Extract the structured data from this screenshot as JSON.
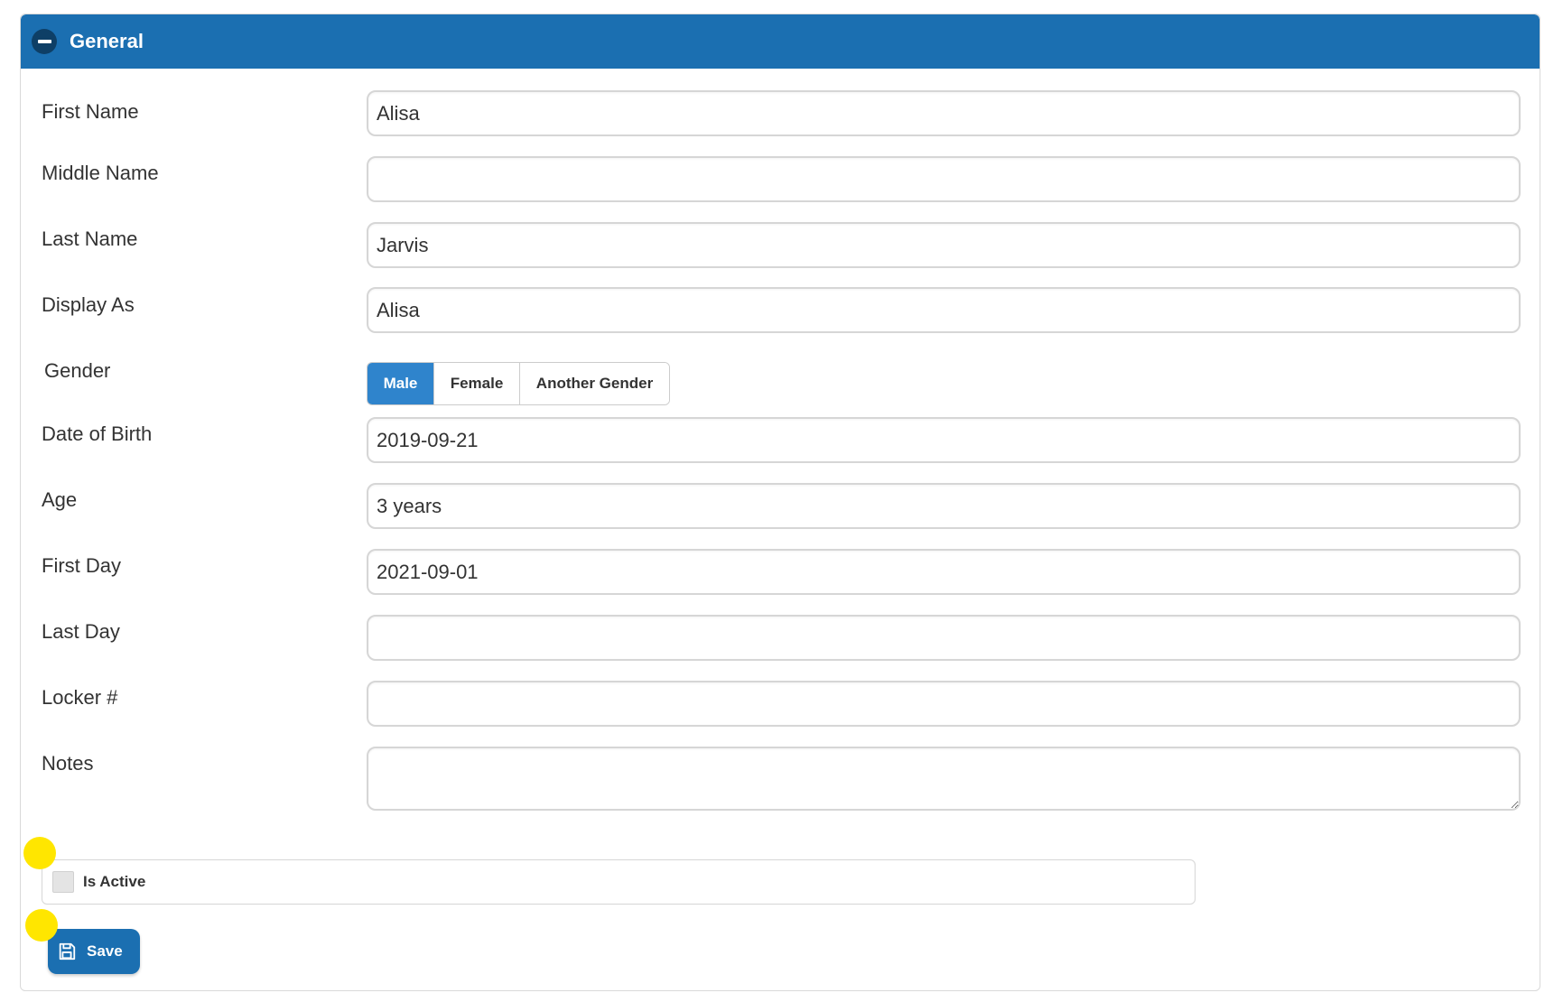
{
  "panel": {
    "title": "General"
  },
  "fields": {
    "first_name": {
      "label": "First Name",
      "value": "Alisa"
    },
    "middle_name": {
      "label": "Middle Name",
      "value": ""
    },
    "last_name": {
      "label": "Last Name",
      "value": "Jarvis"
    },
    "display_as": {
      "label": "Display As",
      "value": "Alisa"
    },
    "gender": {
      "label": "Gender",
      "options": [
        "Male",
        "Female",
        "Another Gender"
      ],
      "selected": "Male"
    },
    "date_of_birth": {
      "label": "Date of Birth",
      "value": "2019-09-21"
    },
    "age": {
      "label": "Age",
      "value": "3 years"
    },
    "first_day": {
      "label": "First Day",
      "value": "2021-09-01"
    },
    "last_day": {
      "label": "Last Day",
      "value": ""
    },
    "locker": {
      "label": "Locker #",
      "value": ""
    },
    "notes": {
      "label": "Notes",
      "value": ""
    }
  },
  "is_active": {
    "label": "Is Active",
    "checked": false
  },
  "save": {
    "label": "Save"
  },
  "colors": {
    "header": "#1b6fb1",
    "active_segment": "#2f84cc",
    "marker": "#ffe600"
  },
  "icons": {
    "collapse": "minus-circle-icon",
    "save": "floppy-disk-icon"
  }
}
